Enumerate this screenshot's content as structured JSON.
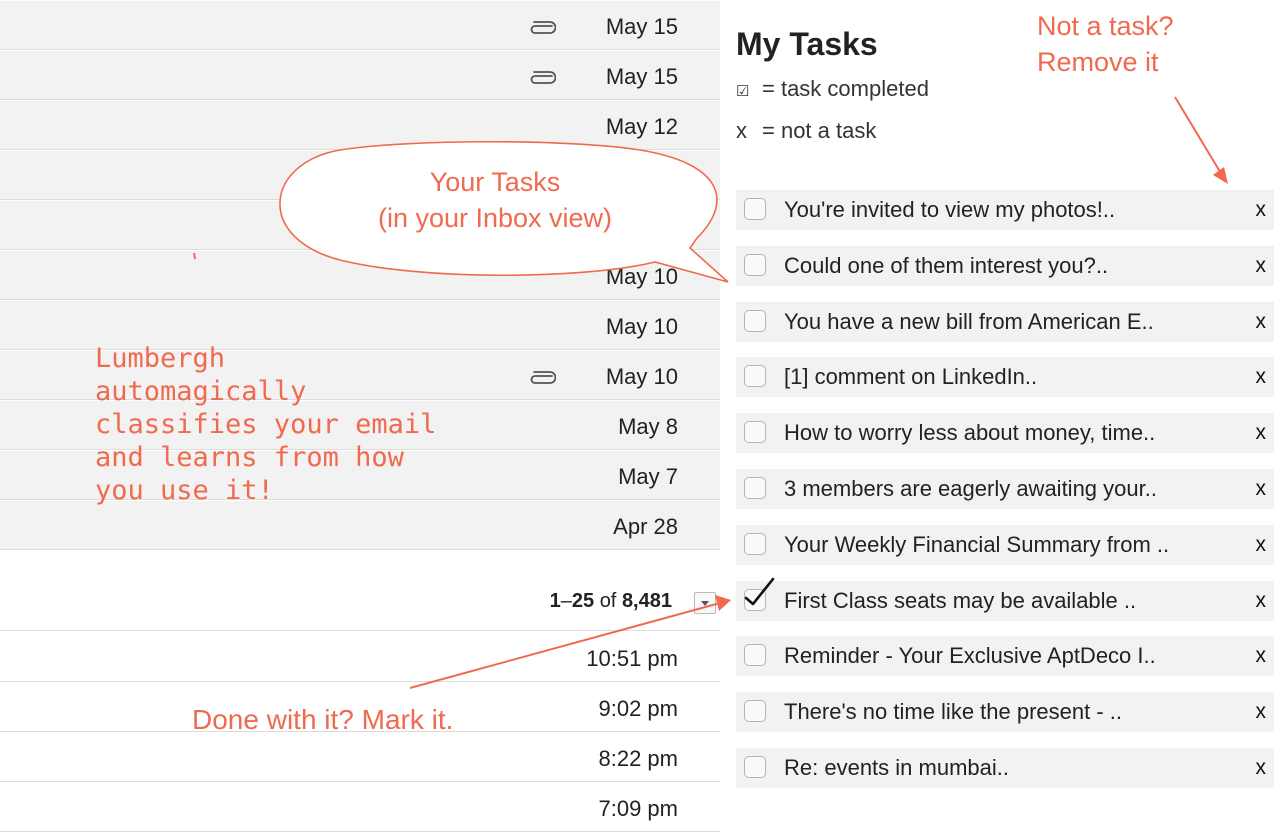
{
  "inbox": {
    "rows_top": [
      {
        "date": "May 15",
        "attachment": true
      },
      {
        "date": "May 15",
        "attachment": true
      },
      {
        "date": "May 12",
        "attachment": false
      },
      {
        "date": "",
        "attachment": false
      },
      {
        "date": "",
        "attachment": false
      },
      {
        "date": "May 10",
        "attachment": false
      },
      {
        "date": "May 10",
        "attachment": false
      },
      {
        "date": "May 10",
        "attachment": true
      },
      {
        "date": "May 8",
        "attachment": false
      },
      {
        "date": "May 7",
        "attachment": false
      },
      {
        "date": "Apr 28",
        "attachment": false
      }
    ],
    "pagination": {
      "range_start": "1",
      "range_sep": "–",
      "range_end": "25",
      "of": "of",
      "total": "8,481"
    },
    "rows_bottom": [
      {
        "date": "10:51 pm"
      },
      {
        "date": "9:02 pm"
      },
      {
        "date": "8:22 pm"
      },
      {
        "date": "7:09 pm"
      }
    ]
  },
  "tasks_panel": {
    "title": "My Tasks",
    "legend": [
      {
        "symbol": "☑",
        "text": "= task completed"
      },
      {
        "symbol": "x",
        "text": "= not a task"
      }
    ],
    "remove_label": "x",
    "tasks": [
      {
        "text": "You're invited to view my photos!..",
        "checked": false
      },
      {
        "text": "Could one of them interest you?..",
        "checked": false
      },
      {
        "text": "You have a new bill from American E..",
        "checked": false
      },
      {
        "text": "[1] comment on LinkedIn..",
        "checked": false
      },
      {
        "text": "How to worry less about money, time..",
        "checked": false
      },
      {
        "text": "3 members are eagerly awaiting your..",
        "checked": false
      },
      {
        "text": "Your Weekly Financial Summary from ..",
        "checked": false
      },
      {
        "text": "First Class seats may be available ..",
        "checked": true
      },
      {
        "text": "Reminder - Your Exclusive AptDeco I..",
        "checked": false
      },
      {
        "text": "There's no time like the present - ..",
        "checked": false
      },
      {
        "text": "Re: events in mumbai..",
        "checked": false
      }
    ]
  },
  "annotations": {
    "bubble_line1": "Your Tasks",
    "bubble_line2": "(in your Inbox view)",
    "remove_note_line1": "Not a task?",
    "remove_note_line2": "Remove it",
    "mark_note": "Done with it? Mark it.",
    "lumbergh_lines": [
      "Lumbergh",
      "automagically",
      "classifies your email",
      "and learns from how",
      "you use it!"
    ],
    "color": "#f06a4f"
  }
}
